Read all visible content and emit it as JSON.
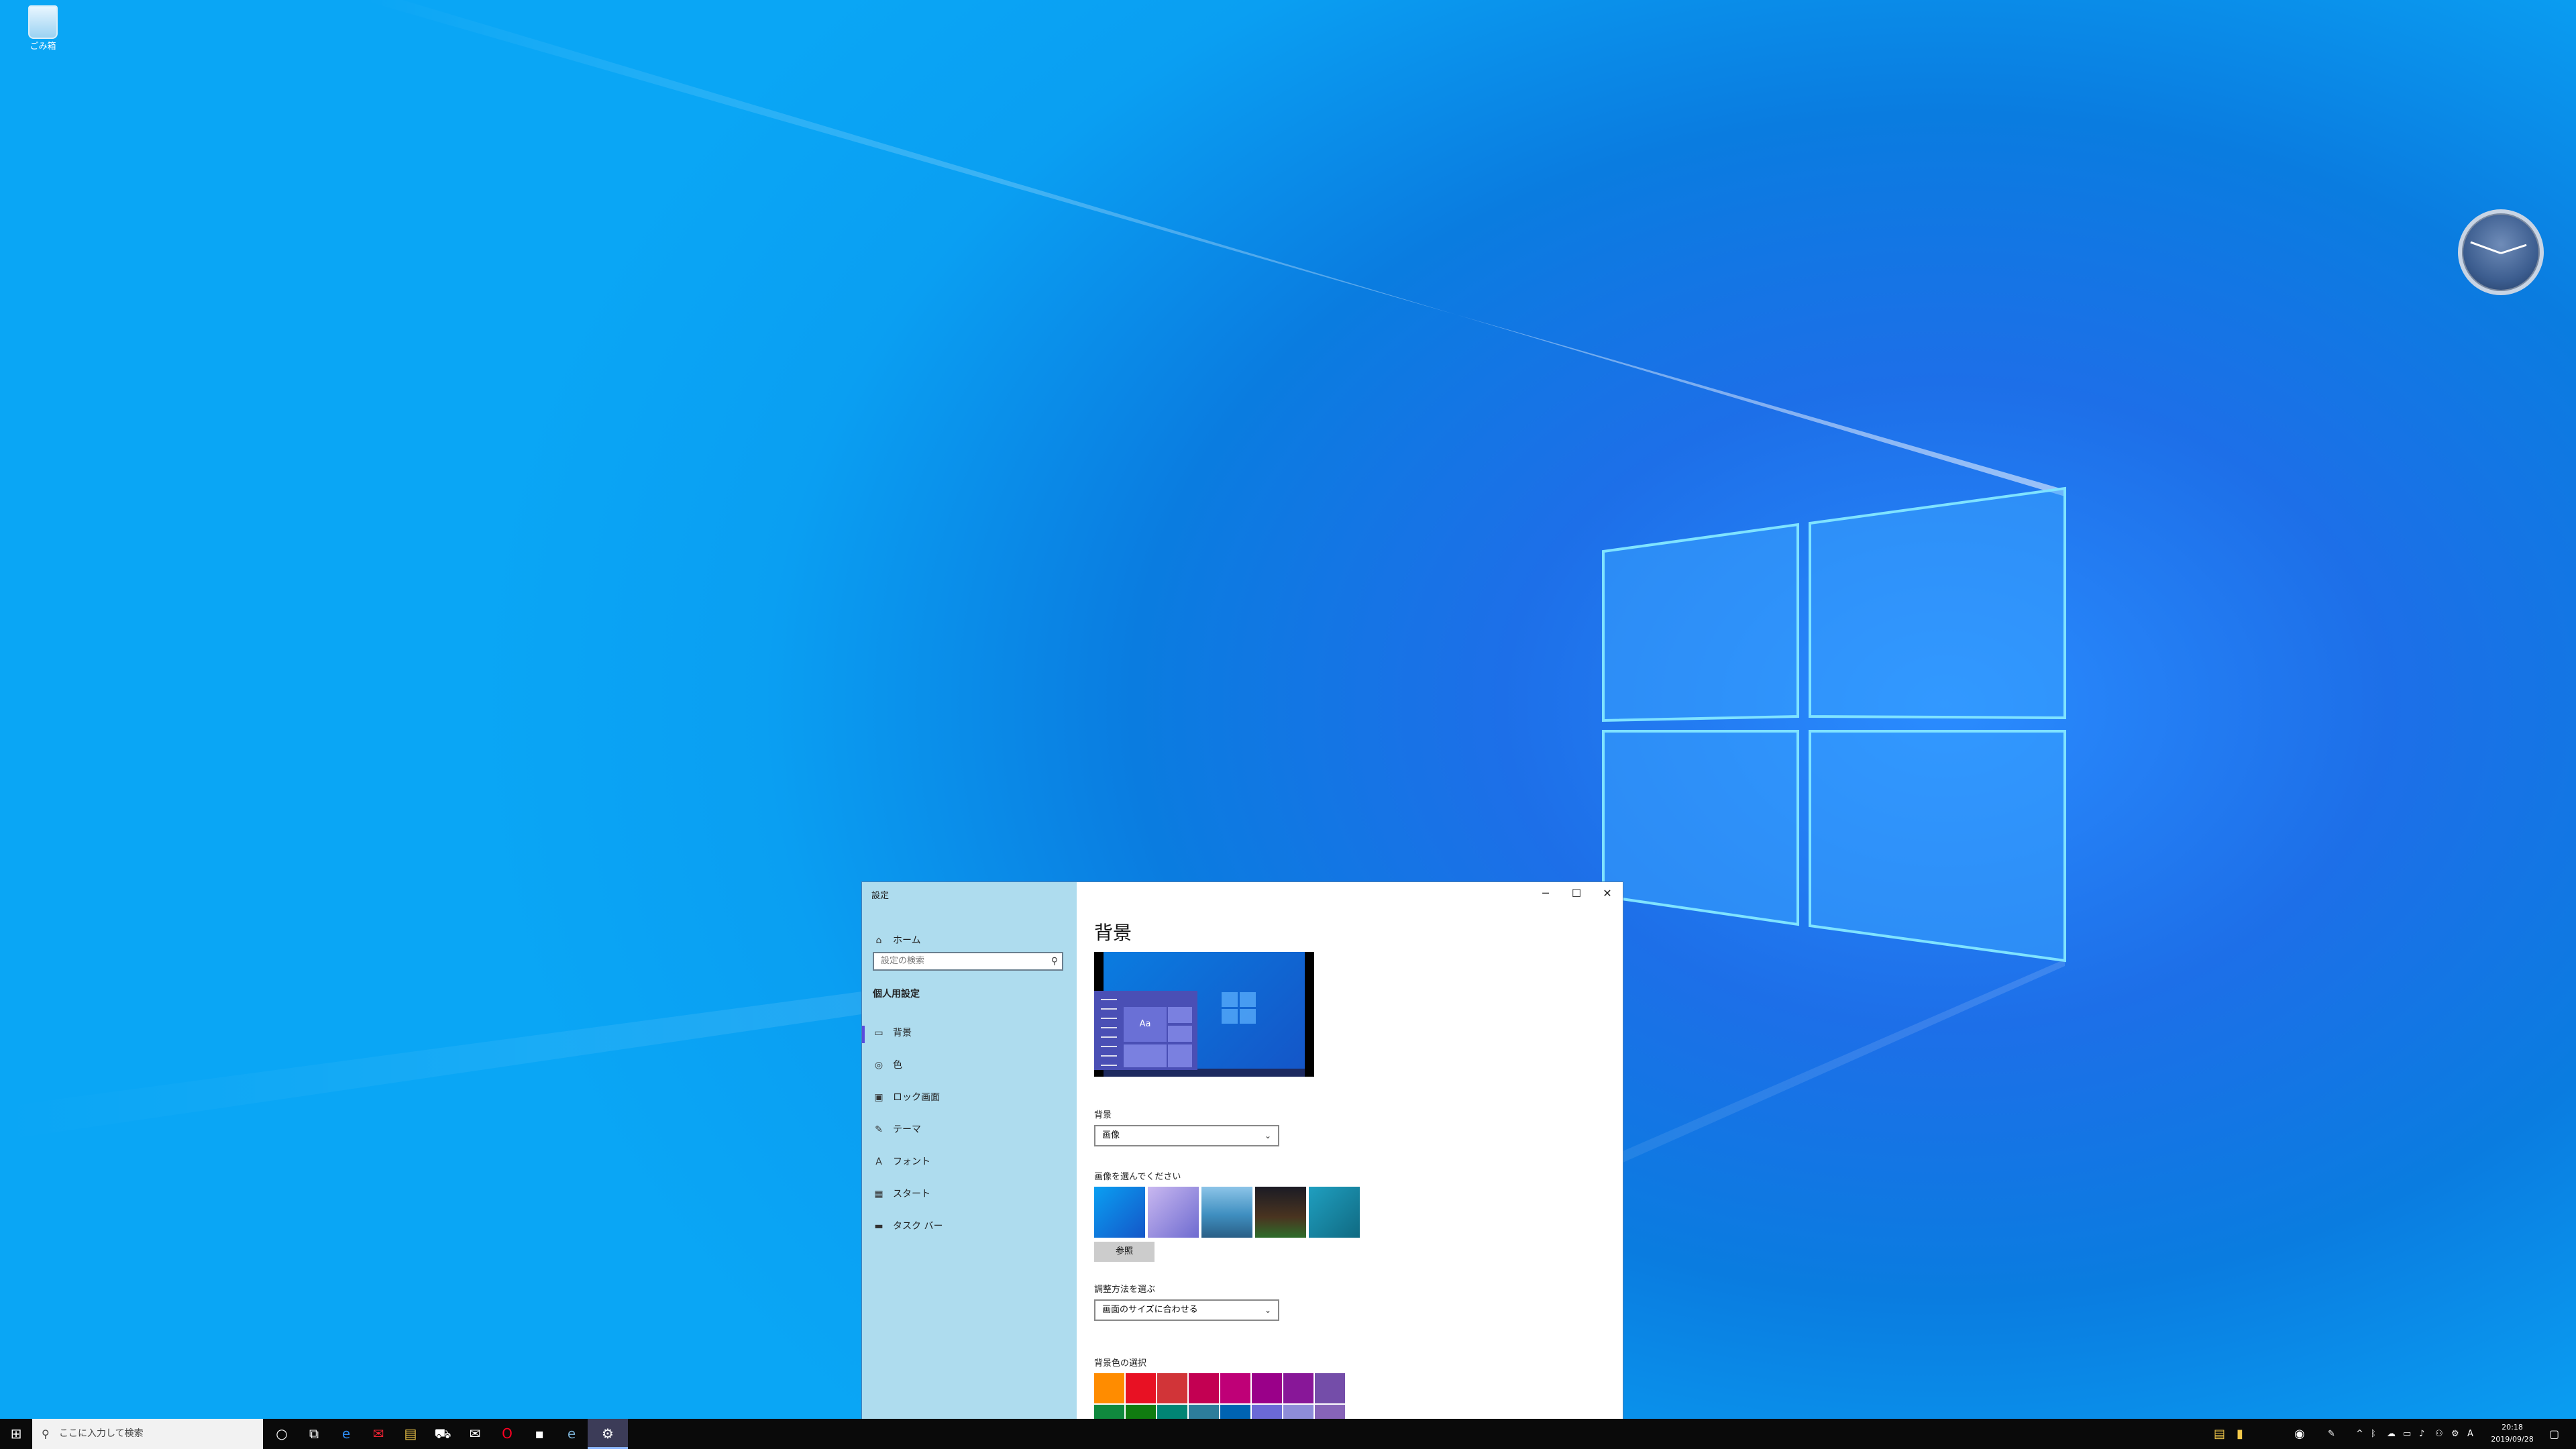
{
  "desktop": {
    "recycle_bin_label": "ごみ箱"
  },
  "settings_window": {
    "title": "設定",
    "controls": {
      "minimize": "─",
      "maximize": "☐",
      "close": "✕"
    },
    "nav": {
      "home": "ホーム",
      "search_placeholder": "設定の検索",
      "section_title": "個人用設定",
      "items": [
        {
          "label": "背景",
          "icon": "image-icon"
        },
        {
          "label": "色",
          "icon": "palette-icon"
        },
        {
          "label": "ロック画面",
          "icon": "lock-screen-icon"
        },
        {
          "label": "テーマ",
          "icon": "theme-icon"
        },
        {
          "label": "フォント",
          "icon": "font-icon"
        },
        {
          "label": "スタート",
          "icon": "start-icon"
        },
        {
          "label": "タスク バー",
          "icon": "taskbar-icon"
        }
      ],
      "selected_index": 0
    },
    "content": {
      "page_title": "背景",
      "preview_sample_text": "Aa",
      "background_label": "背景",
      "background_value": "画像",
      "choose_image_label": "画像を選んでください",
      "browse_button": "参照",
      "fit_label": "調整方法を選ぶ",
      "fit_value": "画面のサイズに合わせる",
      "color_label": "背景色の選択",
      "swatch_colors_row1": [
        "#ff8c00",
        "#e81123",
        "#d13438",
        "#c30052",
        "#bf0077",
        "#9a0089",
        "#881798",
        "#744da9"
      ],
      "swatch_colors_row2": [
        "#10893e",
        "#107c10",
        "#018574",
        "#2d7d9a",
        "#0063b1",
        "#6b69d6",
        "#8e8cd8",
        "#8764b8"
      ]
    }
  },
  "taskbar": {
    "search_placeholder": "ここに入力して検索",
    "time": "20:18",
    "date": "2019/09/28"
  }
}
